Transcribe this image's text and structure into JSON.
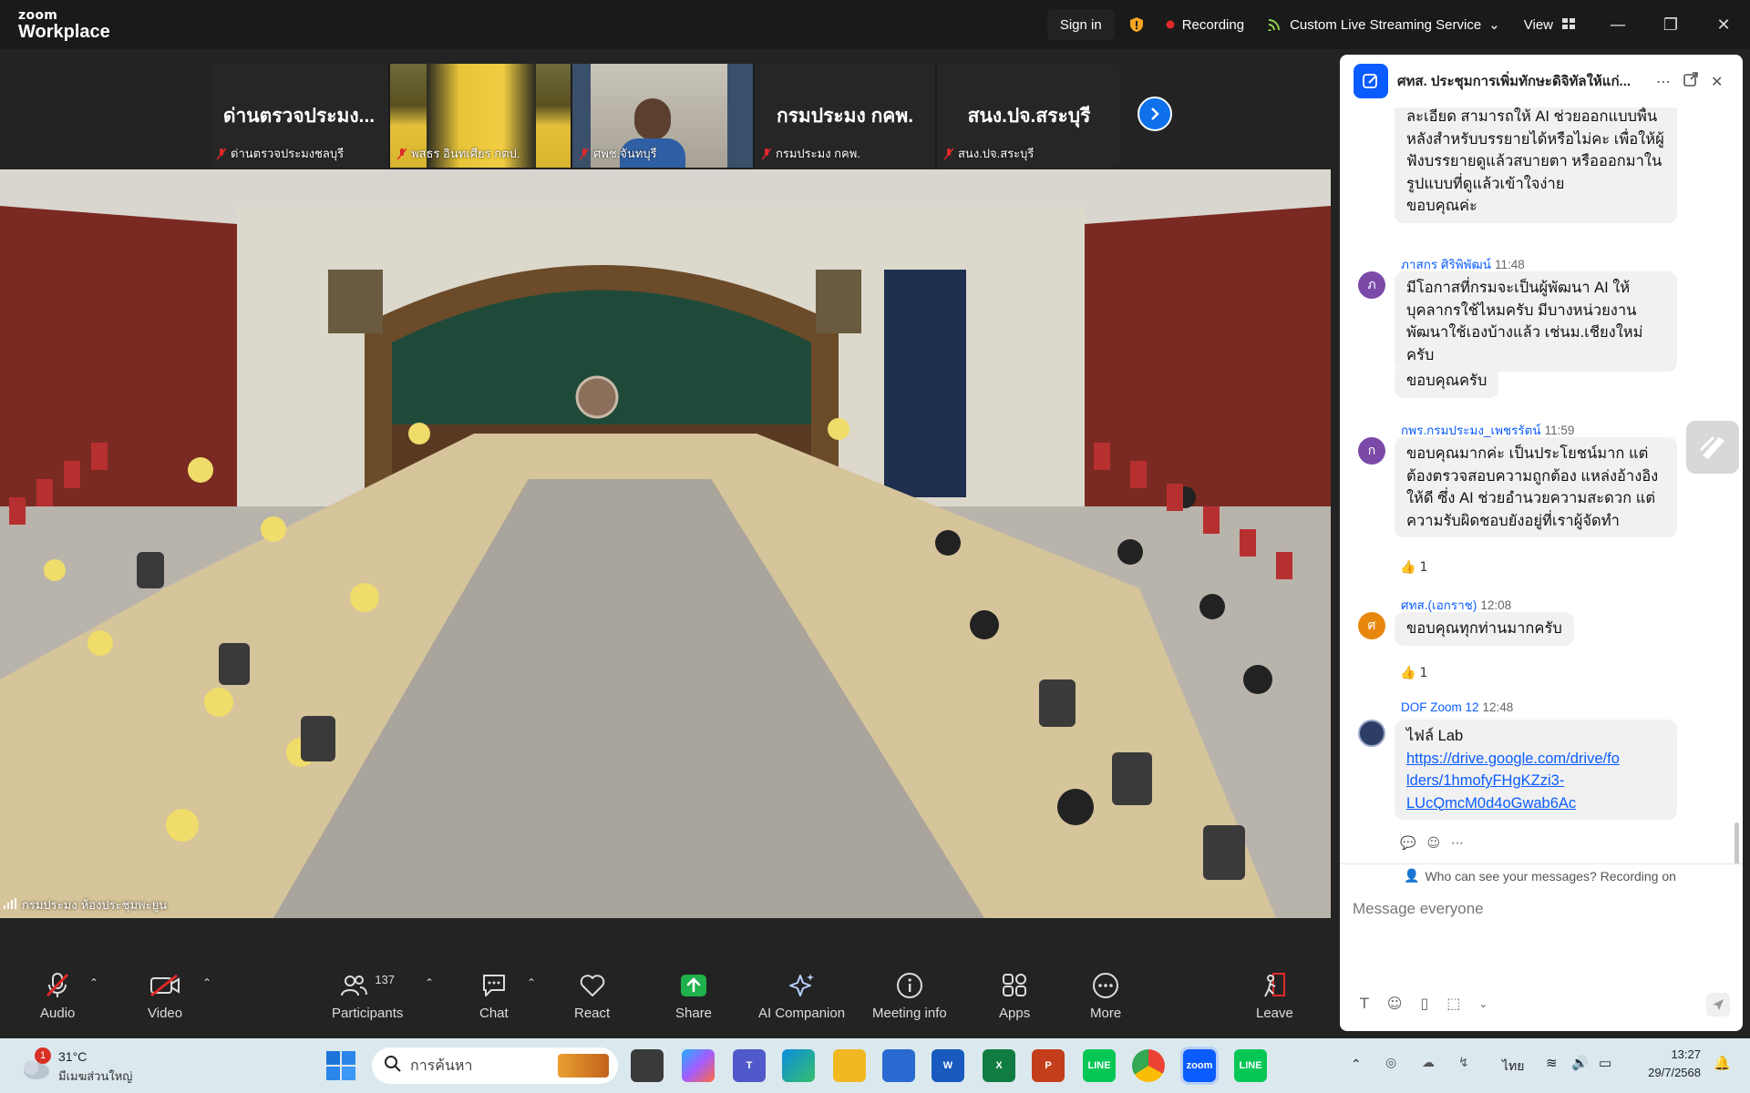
{
  "app": {
    "brand_small": "zoom",
    "brand_main": "Workplace"
  },
  "topbar": {
    "signin": "Sign in",
    "recording": "Recording",
    "stream": "Custom Live Streaming Service",
    "view": "View"
  },
  "strip": [
    {
      "big": "ด่านตรวจประมง...",
      "name": "ด่านตรวจประมงชลบุรี"
    },
    {
      "big": "",
      "name": "พสธร อินทเศียร กตป."
    },
    {
      "big": "",
      "name": "ศพช.จันทบุรี"
    },
    {
      "big": "กรมประมง กคพ.",
      "name": "กรมประมง กคพ."
    },
    {
      "big": "สนง.ปจ.สระบุรี",
      "name": "สนง.ปจ.สระบุรี"
    }
  ],
  "main_video": {
    "label": "กรมประมง ห้องประชุมพะยูน"
  },
  "chat": {
    "title": "ศทส. ประชุมการเพิ่มทักษะดิจิทัลให้แก่...",
    "msg0": [
      "ละเอียด สามารถให้ AI ช่วยออกแบบพื้น",
      "หลังสำหรับบรรยายได้หรือไม่คะ เพื่อให้ผู้",
      "ฟังบรรยายดูแล้วสบายตา หรือออกมาใน",
      "รูปแบบที่ดูแล้วเข้าใจง่าย",
      "ขอบคุณค่ะ"
    ],
    "m1": {
      "sender": "ภาสกร ศิริพิพัฒน์",
      "time": "11:48",
      "avatar": "ภ",
      "lines": [
        "มีโอกาสที่กรมจะเป็นผู้พัฒนา AI ให้",
        "บุคลากรใช้ไหมครับ มีบางหน่วยงาน",
        "พัฒนาใช้เองบ้างแล้ว เช่นม.เชียงใหม่ครับ"
      ],
      "extra": "ขอบคุณครับ"
    },
    "m2": {
      "sender": "กพร.กรมประมง_เพชรรัตน์",
      "time": "11:59",
      "avatar": "ก",
      "lines": [
        "ขอบคุณมากค่ะ เป็นประโยชน์มาก แต่",
        "ต้องตรวจสอบความถูกต้อง แหล่งอ้างอิง",
        "ให้ดี ซึ่ง AI ช่วยอำนวยความสะดวก แต่",
        "ความรับผิดชอบยังอยู่ที่เราผู้จัดทำ"
      ],
      "react": "1"
    },
    "m3": {
      "sender": "ศทส.(เอกราช)",
      "time": "12:08",
      "avatar": "ศ",
      "lines": [
        "ขอบคุณทุกท่านมากครับ"
      ],
      "react": "1"
    },
    "m4": {
      "sender": "DOF Zoom 12",
      "time": "12:48",
      "lines": [
        "ไฟล์ Lab"
      ],
      "link": [
        "https://drive.google.com/drive/fo",
        "lders/1hmofyFHgKZzi3-",
        "LUcQmcM0d4oGwab6Ac"
      ]
    },
    "notice": "Who can see your messages? Recording on",
    "input_placeholder": "Message everyone"
  },
  "toolbar": {
    "audio": "Audio",
    "video": "Video",
    "participants": "Participants",
    "participants_count": "137",
    "chat": "Chat",
    "react": "React",
    "share": "Share",
    "ai": "AI Companion",
    "meeting_info": "Meeting info",
    "apps": "Apps",
    "more": "More",
    "leave": "Leave"
  },
  "taskbar": {
    "weather_badge": "1",
    "temp": "31°C",
    "weather_desc": "มีเมฆส่วนใหญ่",
    "search_placeholder": "การค้นหา",
    "lang": "ไทย",
    "time": "13:27",
    "date": "29/7/2568"
  },
  "colors": {
    "accent": "#0b5cff",
    "share_green": "#1fb14b",
    "record_red": "#e02828",
    "leave_red": "#e02828"
  }
}
